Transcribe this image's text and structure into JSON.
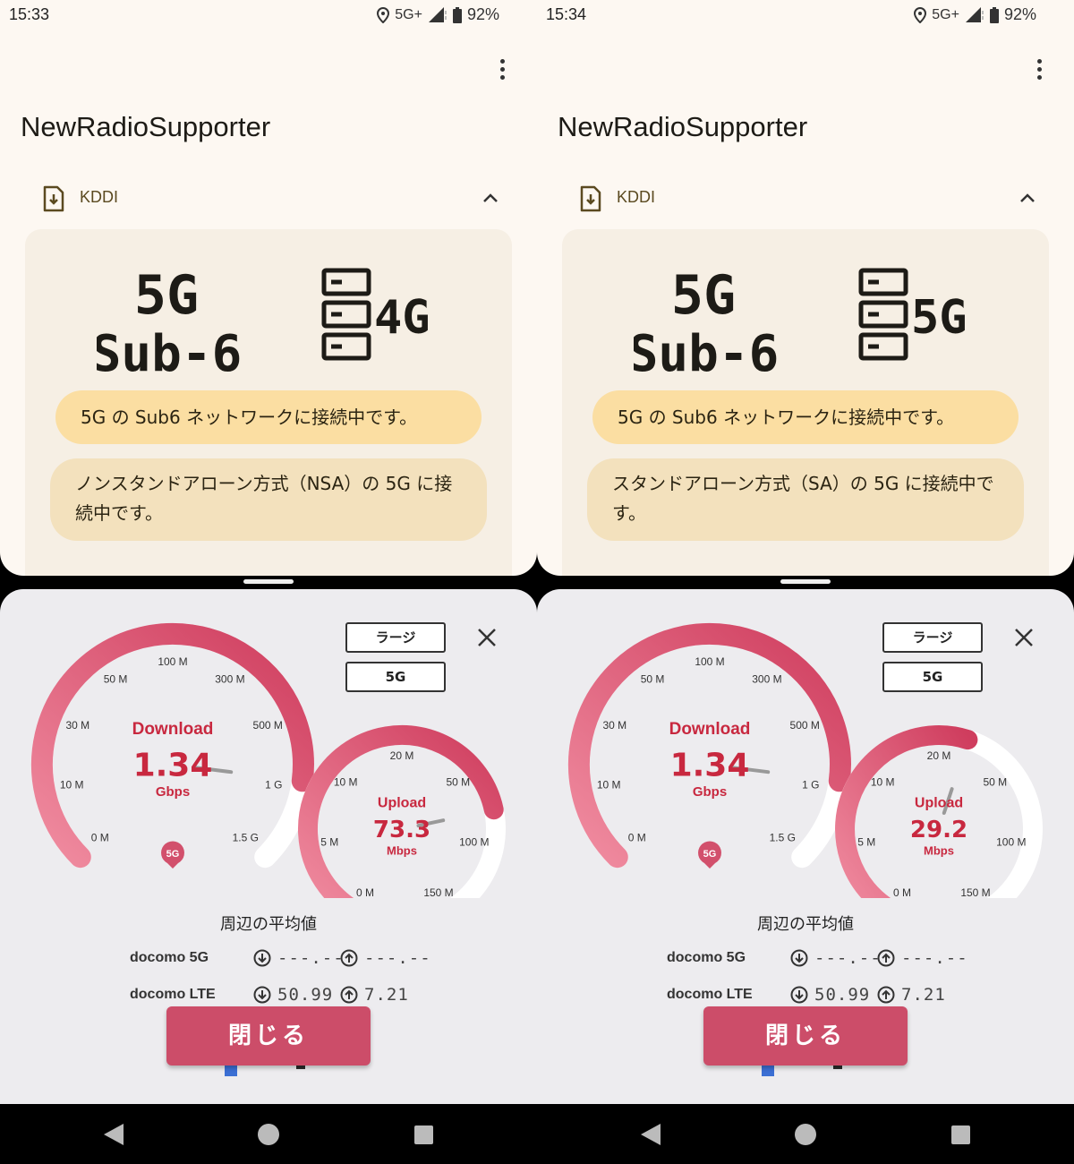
{
  "panels": [
    {
      "status_time": "15:33",
      "network": "5G+",
      "battery": "92%",
      "app_title": "NewRadioSupporter",
      "carrier": "KDDI",
      "nr_line1": "5G",
      "nr_line2": "Sub-6",
      "band_type": "4G",
      "msg_primary": "5G の Sub6 ネットワークに接続中です。",
      "msg_secondary": "ノンスタンドアローン方式（NSA）の 5G に接続中です。",
      "mode_button": "ラージ",
      "network_button": "5G",
      "download": {
        "title": "Download",
        "value": "1.34",
        "unit": "Gbps",
        "fraction": 0.86
      },
      "upload": {
        "title": "Upload",
        "value": "73.3",
        "unit": "Mbps",
        "fraction": 0.76
      },
      "network_badge": "5G",
      "avg_title": "周辺の平均値",
      "avg_rows": [
        {
          "label": "docomo  5G",
          "down": "---.--",
          "up": "---.--"
        },
        {
          "label": "docomo LTE",
          "down": "50.99",
          "up": "7.21"
        }
      ],
      "close_label": "閉じる"
    },
    {
      "status_time": "15:34",
      "network": "5G+",
      "battery": "92%",
      "app_title": "NewRadioSupporter",
      "carrier": "KDDI",
      "nr_line1": "5G",
      "nr_line2": "Sub-6",
      "band_type": "5G",
      "msg_primary": "5G の Sub6 ネットワークに接続中です。",
      "msg_secondary": "スタンドアローン方式（SA）の 5G に接続中です。",
      "mode_button": "ラージ",
      "network_button": "5G",
      "download": {
        "title": "Download",
        "value": "1.34",
        "unit": "Gbps",
        "fraction": 0.86
      },
      "upload": {
        "title": "Upload",
        "value": "29.2",
        "unit": "Mbps",
        "fraction": 0.56
      },
      "network_badge": "5G",
      "avg_title": "周辺の平均値",
      "avg_rows": [
        {
          "label": "docomo  5G",
          "down": "---.--",
          "up": "---.--"
        },
        {
          "label": "docomo LTE",
          "down": "50.99",
          "up": "7.21"
        }
      ],
      "close_label": "閉じる"
    }
  ],
  "download_scale": [
    "0 M",
    "10 M",
    "30 M",
    "50 M",
    "100 M",
    "300 M",
    "500 M",
    "1 G",
    "1.5 G"
  ],
  "upload_scale": [
    "0 M",
    "5 M",
    "10 M",
    "20 M",
    "50 M",
    "100 M",
    "150 M"
  ],
  "colors": {
    "gauge_light": "#f08ca0",
    "gauge_dark": "#cf3d5e",
    "accent": "#c8283f",
    "close_button": "#cc4d69"
  }
}
